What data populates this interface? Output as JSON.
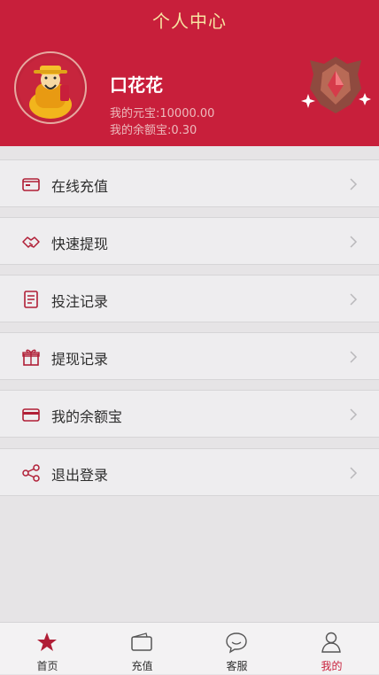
{
  "header": {
    "title": "个人中心",
    "username": "口花花",
    "balance_line": "我的元宝:10000.00",
    "yuebao_line": "我的余额宝:0.30",
    "accent_color": "#c81f3b"
  },
  "menu": [
    {
      "label": "在线充值",
      "icon": "wallet-icon"
    },
    {
      "label": "快速提现",
      "icon": "handshake-icon"
    },
    {
      "label": "投注记录",
      "icon": "receipt-icon"
    },
    {
      "label": "提现记录",
      "icon": "gift-icon"
    },
    {
      "label": "我的余额宝",
      "icon": "card-icon"
    },
    {
      "label": "退出登录",
      "icon": "share-icon"
    }
  ],
  "tabbar": {
    "items": [
      {
        "label": "首页",
        "icon": "star-icon"
      },
      {
        "label": "充值",
        "icon": "wallet-icon"
      },
      {
        "label": "客服",
        "icon": "chat-bubble-icon"
      },
      {
        "label": "我的",
        "icon": "user-icon"
      }
    ],
    "active_index": 3
  }
}
